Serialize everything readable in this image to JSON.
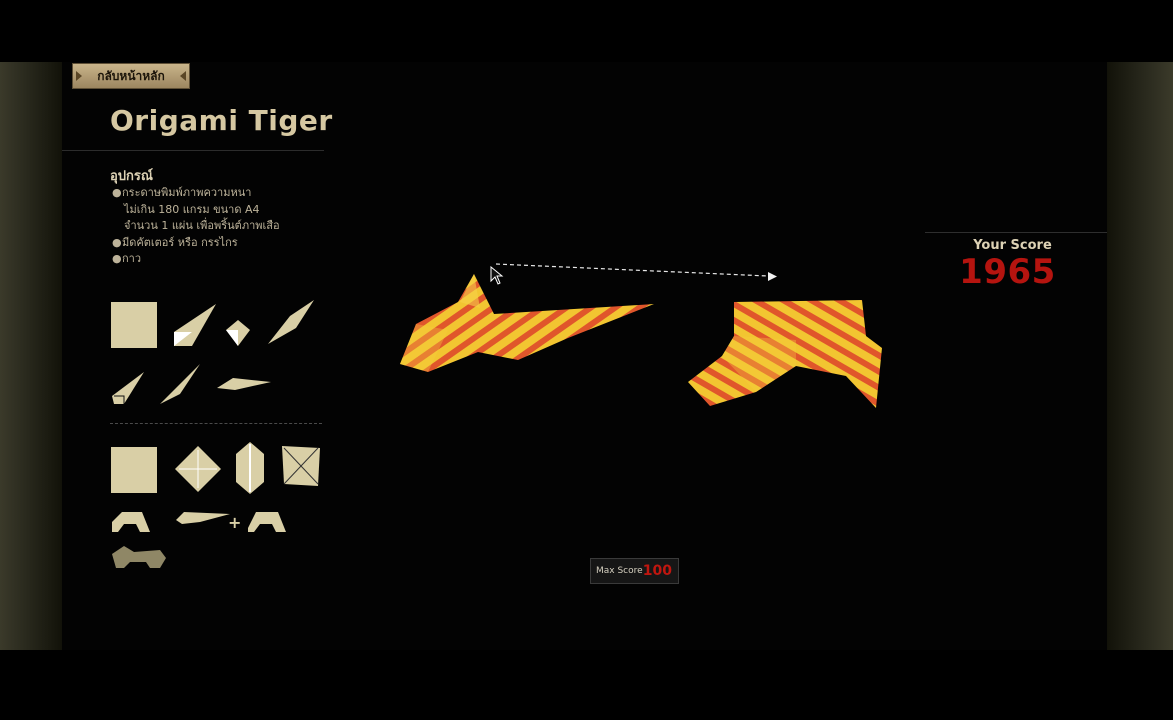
{
  "nav": {
    "back_label": "กลับหน้าหลัก"
  },
  "page": {
    "title": "Origami Tiger"
  },
  "materials": {
    "heading": "อุปกรณ์",
    "items": [
      {
        "lines": [
          "กระดาษพิมพ์ภาพความหนา",
          "ไม่เกิน 180 แกรม ขนาด A4",
          "จำนวน 1 แผ่น เพื่อพริ้นต์ภาพเสือ"
        ]
      },
      {
        "lines": [
          "มีดคัตเตอร์ หรือ กรรไกร"
        ]
      },
      {
        "lines": [
          "กาว"
        ]
      }
    ]
  },
  "score": {
    "label": "Your Score",
    "value": "1965"
  },
  "max_score": {
    "label": "Max Score",
    "value": "100"
  },
  "colors": {
    "paper": "#d9cfa6",
    "score_red": "#b5140f",
    "tiger_orange": "#e0562b",
    "tiger_yellow": "#f2c531"
  },
  "icons": {
    "plus": "+"
  }
}
